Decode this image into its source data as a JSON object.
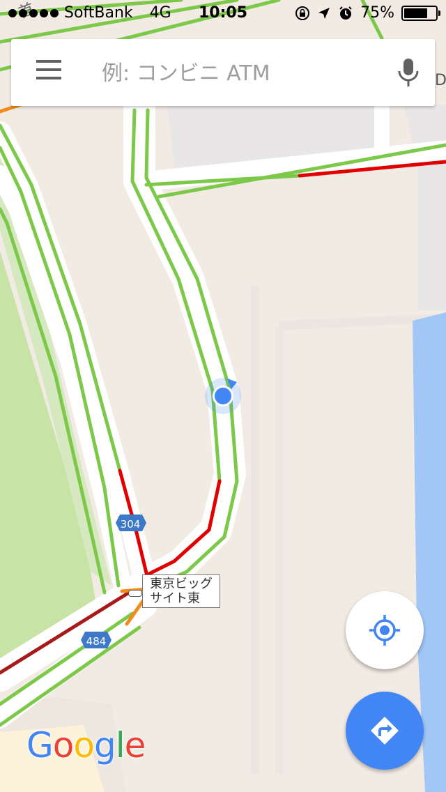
{
  "status_bar": {
    "carrier": "SoftBank",
    "network": "4G",
    "time": "10:05",
    "battery_percent": "75%",
    "battery_level": 0.75,
    "icons": [
      "orientation-lock-icon",
      "location-arrow-icon",
      "alarm-icon"
    ]
  },
  "search": {
    "placeholder": "例: コンビニ ATM",
    "menu_icon": "hamburger-menu-icon",
    "mic_icon": "microphone-icon"
  },
  "map": {
    "route_shields": [
      "304",
      "484"
    ],
    "place_label": "東京ビッグ\nサイト東",
    "background_text": [
      "首",
      "D"
    ],
    "colors": {
      "land": "#f1ebe4",
      "park": "#c8e3a6",
      "water": "#a2c7f7",
      "traffic_green": "#7cc849",
      "traffic_red": "#e00000",
      "traffic_dark_red": "#a81a1a",
      "traffic_orange": "#f28b1d",
      "shield": "#3d78c9",
      "location_dot": "#4285f4"
    }
  },
  "buttons": {
    "my_location_icon": "my-location-icon",
    "directions_icon": "directions-icon"
  },
  "logo": {
    "text": "Google",
    "letters": [
      "G",
      "o",
      "o",
      "g",
      "l",
      "e"
    ],
    "colors": [
      "#4285f4",
      "#ea4335",
      "#fbbc05",
      "#4285f4",
      "#34a853",
      "#ea4335"
    ]
  }
}
